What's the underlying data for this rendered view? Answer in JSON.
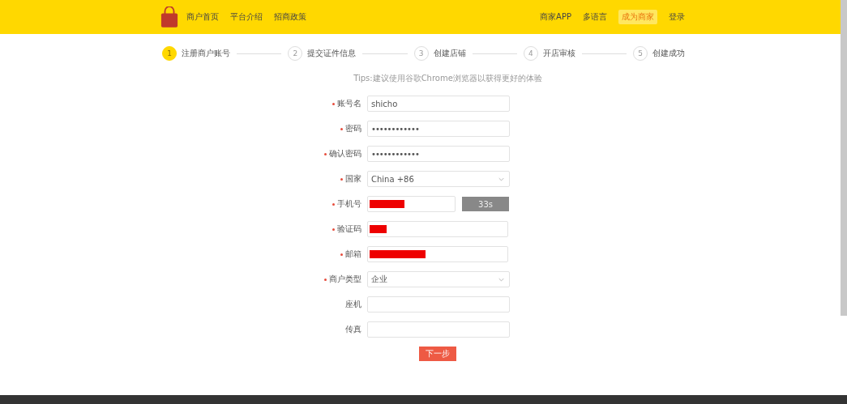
{
  "header": {
    "nav": [
      {
        "label": "商户首页",
        "selected": false
      },
      {
        "label": "平台介绍",
        "selected": false
      },
      {
        "label": "招商政策",
        "selected": false
      }
    ],
    "right_nav": [
      {
        "label": "商家APP",
        "selected": false
      },
      {
        "label": "多语言",
        "selected": false
      },
      {
        "label": "成为商家",
        "selected": true
      },
      {
        "label": "登录",
        "selected": false
      }
    ]
  },
  "steps": [
    {
      "number": "1",
      "label": "注册商户账号",
      "selected": true
    },
    {
      "number": "2",
      "label": "提交证件信息",
      "selected": false
    },
    {
      "number": "3",
      "label": "创建店铺",
      "selected": false
    },
    {
      "number": "4",
      "label": "开店审核",
      "selected": false
    },
    {
      "number": "5",
      "label": "创建成功",
      "selected": false
    }
  ],
  "tips": "Tips:建议使用谷歌Chrome浏览器以获得更好的体验",
  "fields": [
    {
      "label": "账号名",
      "required": true,
      "kind": "text",
      "value": "shicho"
    },
    {
      "label": "密码",
      "required": true,
      "kind": "password",
      "value": "••••••••••••"
    },
    {
      "label": "确认密码",
      "required": true,
      "kind": "password",
      "value": "••••••••••••"
    },
    {
      "label": "国家",
      "required": true,
      "kind": "select",
      "value": "China +86"
    },
    {
      "label": "手机号",
      "required": true,
      "kind": "redacted-code",
      "level": 0.4,
      "button": "33s"
    },
    {
      "label": "验证码",
      "required": true,
      "kind": "redacted",
      "level": 0.12
    },
    {
      "label": "邮箱",
      "required": true,
      "kind": "redacted",
      "level": 0.4
    },
    {
      "label": "商户类型",
      "required": true,
      "kind": "select",
      "value": "企业"
    },
    {
      "label": "座机",
      "required": false,
      "kind": "text"
    },
    {
      "label": "传真",
      "required": false,
      "kind": "text"
    }
  ],
  "submit": "下一步"
}
